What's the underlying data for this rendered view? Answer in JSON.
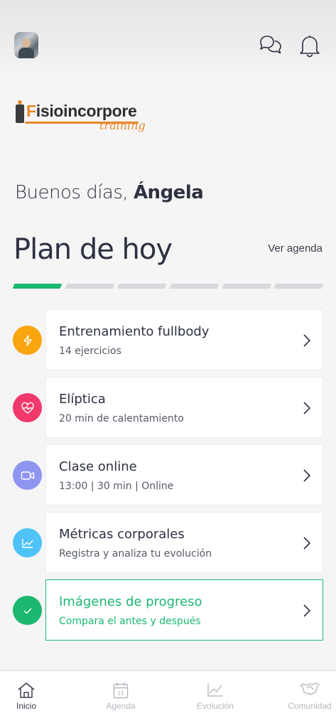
{
  "header": {
    "avatar_icon": "user-avatar",
    "chat_icon": "chat-bubbles-icon",
    "bell_icon": "bell-icon"
  },
  "logo": {
    "brand_prefix": "F",
    "brand_rest": "isioincorpore",
    "tagline": "training",
    "accent_color": "#e8892b"
  },
  "greeting": {
    "prefix": "Buenos días,",
    "name": "Ángela"
  },
  "plan": {
    "title": "Plan de hoy",
    "agenda_link": "Ver agenda",
    "steps_total": 6,
    "steps_done": 1,
    "progress_color": "#1db870"
  },
  "tasks": [
    {
      "title": "Entrenamiento fullbody",
      "subtitle": "14 ejercicios",
      "icon": "lightning-icon",
      "color": "#f9a50f"
    },
    {
      "title": "Elíptica",
      "subtitle": "20 min de calentamiento",
      "icon": "heart-pulse-icon",
      "color": "#f0386b"
    },
    {
      "title": "Clase online",
      "subtitle": "13:00 | 30 min | Online",
      "icon": "video-camera-icon",
      "color": "#8e95f0"
    },
    {
      "title": "Métricas corporales",
      "subtitle": "Registra y analiza tu evolución",
      "icon": "chart-line-icon",
      "color": "#4fc3f7"
    },
    {
      "title": "Imágenes de progreso",
      "subtitle": "Compara el antes y después",
      "icon": "check-icon",
      "color": "#1db870",
      "highlighted": true
    }
  ],
  "nav": {
    "items": [
      {
        "label": "Inicio",
        "icon": "home-icon",
        "active": true
      },
      {
        "label": "Agenda",
        "icon": "calendar-icon",
        "calendar_day": "31"
      },
      {
        "label": "Evolución",
        "icon": "trend-icon"
      },
      {
        "label": "Comunidad",
        "icon": "handshake-icon"
      }
    ]
  }
}
